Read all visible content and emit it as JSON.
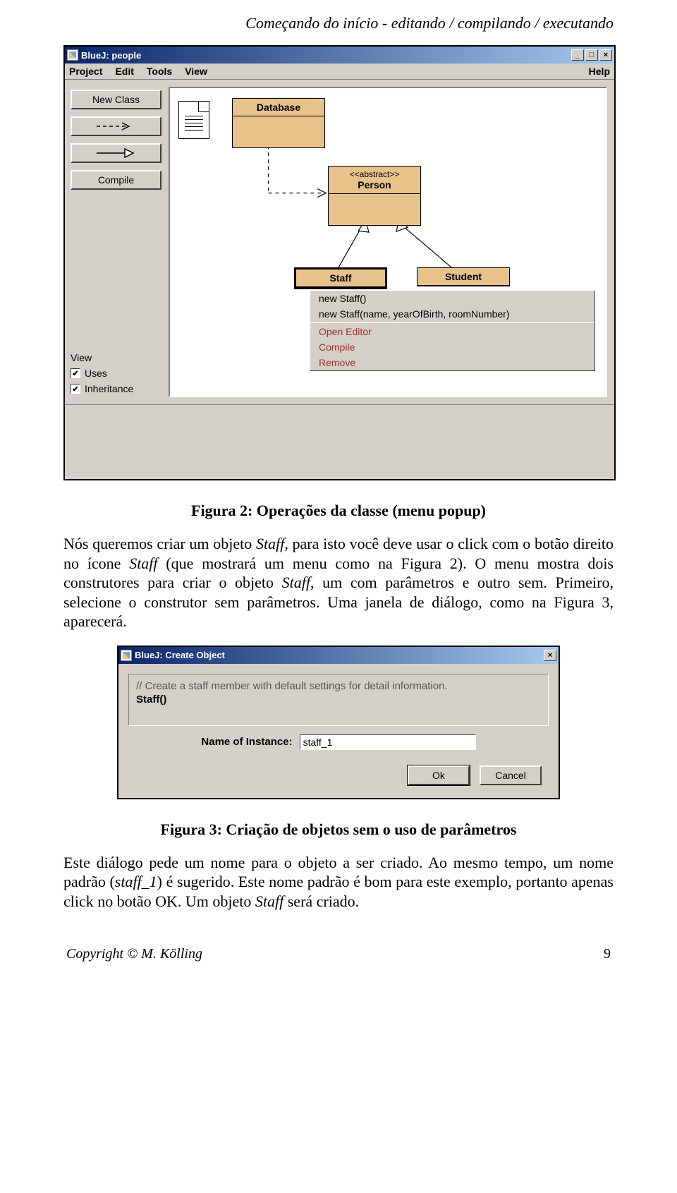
{
  "header": "Começando do início - editando / compilando / executando",
  "bluej": {
    "title": "BlueJ:  people",
    "menus": [
      "Project",
      "Edit",
      "Tools",
      "View"
    ],
    "help": "Help",
    "sidebar": {
      "new_class": "New Class",
      "compile": "Compile",
      "view_label": "View",
      "uses": "Uses",
      "inheritance": "Inheritance"
    },
    "classes": {
      "database": "Database",
      "person_stereo": "<<abstract>>",
      "person": "Person",
      "staff": "Staff",
      "student": "Student"
    },
    "context": {
      "items": [
        "new Staff()",
        "new Staff(name, yearOfBirth, roomNumber)"
      ],
      "actions": [
        "Open Editor",
        "Compile",
        "Remove"
      ]
    }
  },
  "caption1": "Figura 2: Operações da classe (menu popup)",
  "para1_a": "Nós queremos criar um objeto ",
  "para1_b": ", para isto você deve usar o click com o botão direito no ícone ",
  "para1_c": " (que mostrará um menu como na Figura 2). O menu mostra dois construtores para criar o objeto ",
  "para1_d": ", um com parâmetros e outro sem. Primeiro, selecione o construtor sem parâmetros. Uma janela de diálogo, como na Figura 3, aparecerá.",
  "staff_word": "Staff",
  "dialog": {
    "title": "BlueJ:  Create Object",
    "comment": "// Create a staff member with default settings for detail information.",
    "sig": "Staff()",
    "label": "Name of Instance:",
    "value": "staff_1",
    "ok": "Ok",
    "cancel": "Cancel"
  },
  "caption2": "Figura 3: Criação de objetos sem o uso de parâmetros",
  "para2_a": "Este diálogo pede um nome para o objeto a ser criado. Ao mesmo tempo, um nome padrão (",
  "para2_b": ") é sugerido. Este nome padrão é bom para este exemplo, portanto apenas click no botão OK. Um objeto ",
  "para2_c": " será criado.",
  "staff1_word": "staff_1",
  "footer_left": "Copyright © M. Kölling",
  "footer_right": "9"
}
